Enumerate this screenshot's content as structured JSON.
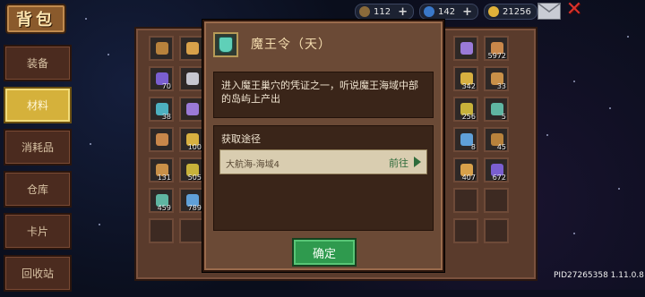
{
  "bag_title": "背包",
  "resources": [
    {
      "value": "112",
      "color": "#8a6a3a",
      "icon": "scroll-icon"
    },
    {
      "value": "142",
      "color": "#3a78c8",
      "icon": "fish-icon"
    },
    {
      "value": "21256",
      "color": "#e0b23a",
      "icon": "coin-icon"
    }
  ],
  "sidebar": {
    "items": [
      {
        "label": "装备",
        "active": false
      },
      {
        "label": "材料",
        "active": true
      },
      {
        "label": "消耗品",
        "active": false
      },
      {
        "label": "仓库",
        "active": false
      },
      {
        "label": "卡片",
        "active": false
      },
      {
        "label": "回收站",
        "active": false
      }
    ]
  },
  "inventory": {
    "left_items": [
      {
        "num": ""
      },
      {
        "num": ""
      },
      {
        "num": "70"
      },
      {
        "num": ""
      },
      {
        "num": "38"
      },
      {
        "num": ""
      },
      {
        "num": ""
      },
      {
        "num": "100"
      },
      {
        "num": "131"
      },
      {
        "num": "505"
      },
      {
        "num": "459"
      },
      {
        "num": "789"
      }
    ],
    "right_items": [
      {
        "num": ""
      },
      {
        "num": "5972"
      },
      {
        "num": "342"
      },
      {
        "num": "33"
      },
      {
        "num": "256"
      },
      {
        "num": "5"
      },
      {
        "num": "8"
      },
      {
        "num": "45"
      },
      {
        "num": "407"
      },
      {
        "num": "672"
      }
    ]
  },
  "dialog": {
    "title": "魔王令（天）",
    "description": "进入魔王巢穴的凭证之一，听说魔王海域中部的岛屿上产出",
    "obtain_title": "获取途径",
    "route": {
      "name": "大航海-海域4",
      "go": "前往"
    },
    "confirm": "确定"
  },
  "footer": {
    "pid": "PID27265358 1.11.0.8"
  }
}
